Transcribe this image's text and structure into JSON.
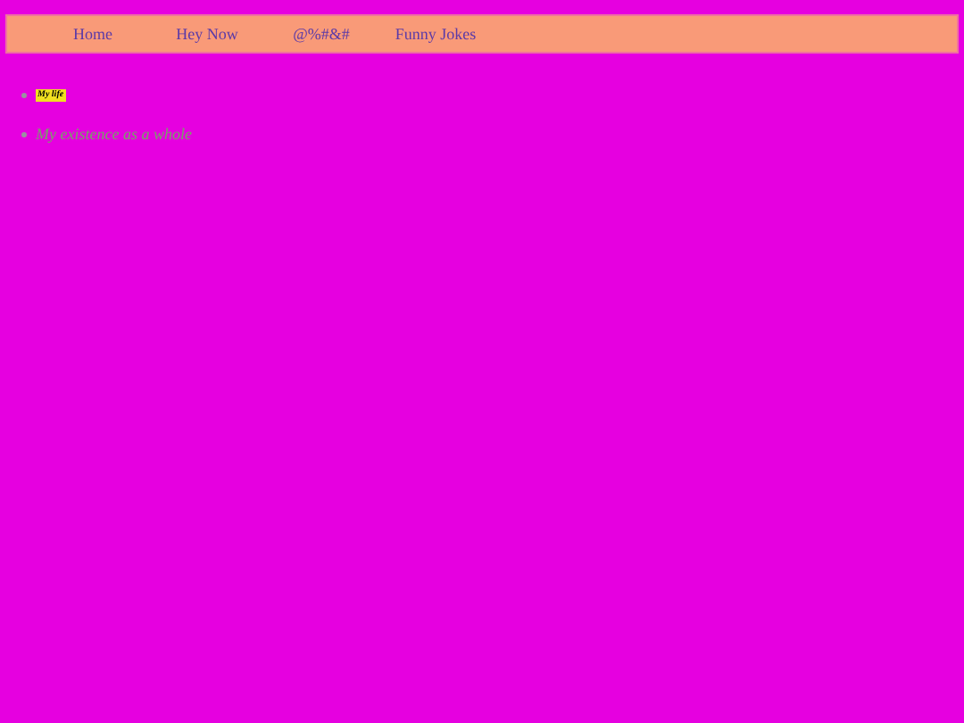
{
  "nav": {
    "links": [
      "Home",
      "Hey Now",
      "@%#&#",
      "Funny Jokes"
    ]
  },
  "list": {
    "items": [
      {
        "kind": "tag",
        "text": "My life"
      },
      {
        "kind": "heading",
        "text": "My existence as a whole"
      }
    ]
  }
}
